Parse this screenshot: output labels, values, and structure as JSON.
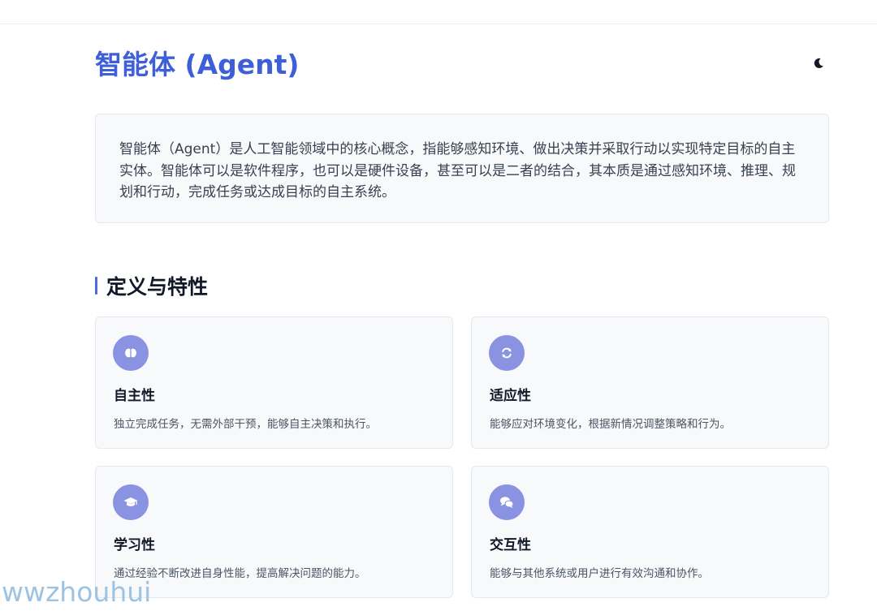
{
  "header": {
    "title": "智能体 (Agent)",
    "theme_toggle_icon": "moon-icon"
  },
  "intro": {
    "text": "智能体（Agent）是人工智能领域中的核心概念，指能够感知环境、做出决策并采取行动以实现特定目标的自主实体。智能体可以是软件程序，也可以是硬件设备，甚至可以是二者的结合，其本质是通过感知环境、推理、规划和行动，完成任务或达成目标的自主系统。"
  },
  "section": {
    "title": "定义与特性"
  },
  "cards": [
    {
      "icon": "brain-icon",
      "title": "自主性",
      "desc": "独立完成任务，无需外部干预，能够自主决策和执行。"
    },
    {
      "icon": "sync-icon",
      "title": "适应性",
      "desc": "能够应对环境变化，根据新情况调整策略和行为。"
    },
    {
      "icon": "graduation-cap-icon",
      "title": "学习性",
      "desc": "通过经验不断改进自身性能，提高解决问题的能力。"
    },
    {
      "icon": "chat-bubbles-icon",
      "title": "交互性",
      "desc": "能够与其他系统或用户进行有效沟通和协作。"
    }
  ],
  "watermark": {
    "text": "wwzhouhui"
  },
  "colors": {
    "accent": "#3f5fd8",
    "icon_bg": "#8a93e2",
    "card_bg": "#f8f9fb"
  }
}
